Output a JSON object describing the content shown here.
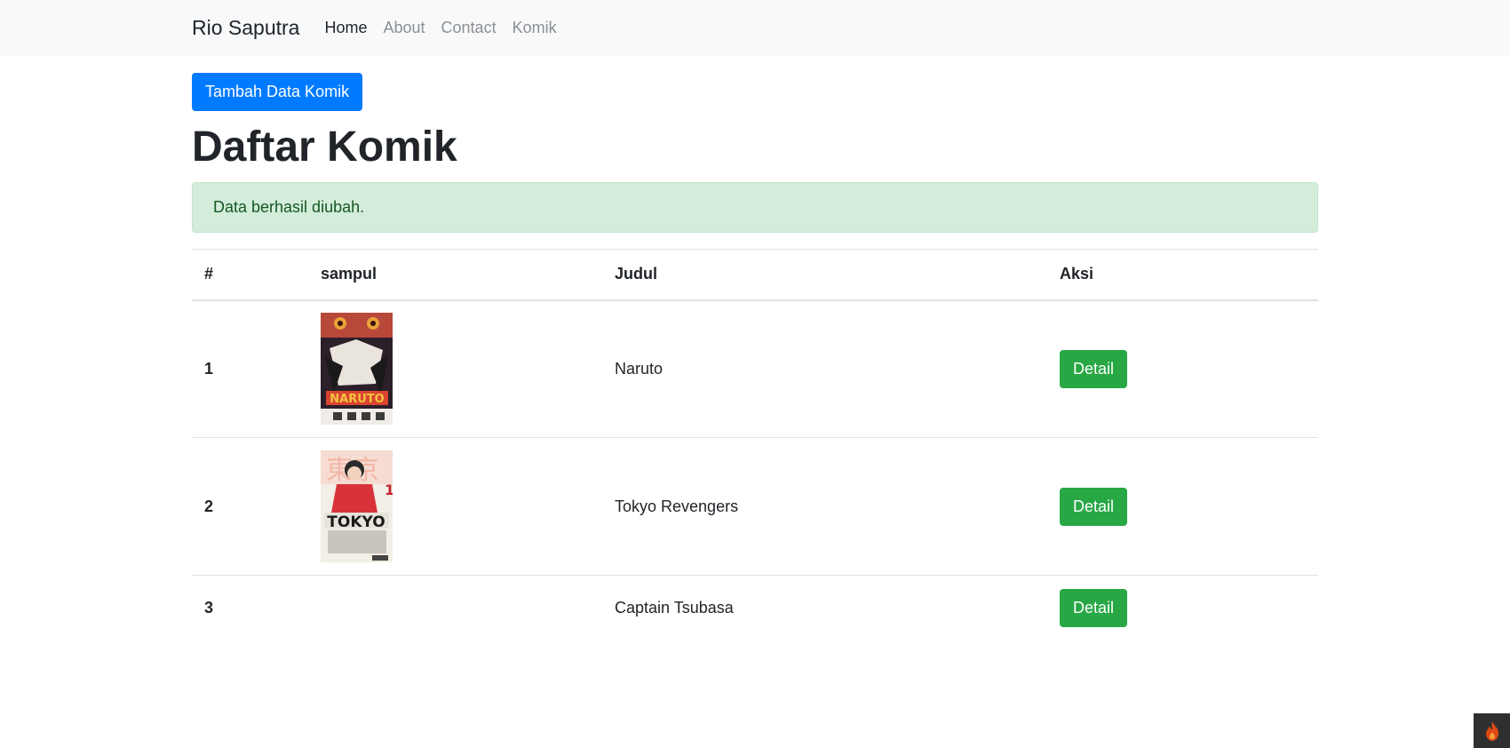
{
  "navbar": {
    "brand": "Rio Saputra",
    "links": [
      "Home",
      "About",
      "Contact",
      "Komik"
    ],
    "active": "Home"
  },
  "main": {
    "add_button": "Tambah Data Komik",
    "title": "Daftar Komik",
    "alert": "Data berhasil diubah.",
    "table": {
      "headers": [
        "#",
        "sampul",
        "Judul",
        "Aksi"
      ],
      "rows": [
        {
          "num": "1",
          "title": "Naruto",
          "cover": "naruto-cover",
          "action": "Detail"
        },
        {
          "num": "2",
          "title": "Tokyo Revengers",
          "cover": "tokyo-revengers-cover",
          "action": "Detail"
        },
        {
          "num": "3",
          "title": "Captain Tsubasa",
          "cover": "",
          "action": "Detail"
        }
      ]
    }
  },
  "colors": {
    "primary": "#007bff",
    "success": "#28a745",
    "alert_bg": "#d4edda",
    "alert_text": "#155724",
    "navbar_bg": "#f8f9fa"
  },
  "icons": {
    "corner_widget": "flame-icon"
  }
}
